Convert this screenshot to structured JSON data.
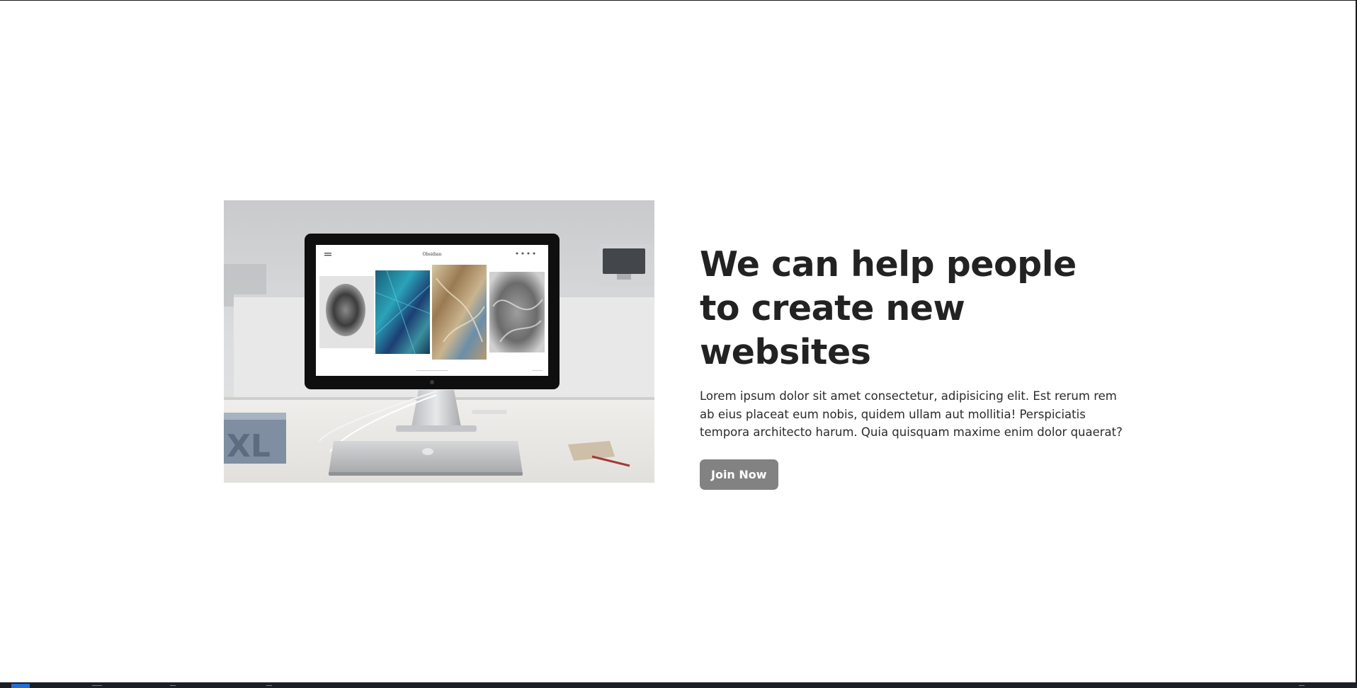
{
  "hero": {
    "image_alt": "Desktop computer on a white desk showing a website with four textured images",
    "monitor_screen_title": "Obsidian",
    "book_spine_text": "XL",
    "title": "We can help people to create new websites",
    "body": "Lorem ipsum dolor sit amet consectetur, adipisicing elit. Est rerum rem ab eius placeat eum nobis, quidem ullam aut mollitia! Perspiciatis tempora architecto harum. Quia quisquam maxime enim dolor quaerat?",
    "cta_label": "Join Now"
  },
  "colors": {
    "button_bg": "#828282",
    "button_text": "#ffffff",
    "heading": "#222222",
    "page_bg": "#ffffff"
  }
}
